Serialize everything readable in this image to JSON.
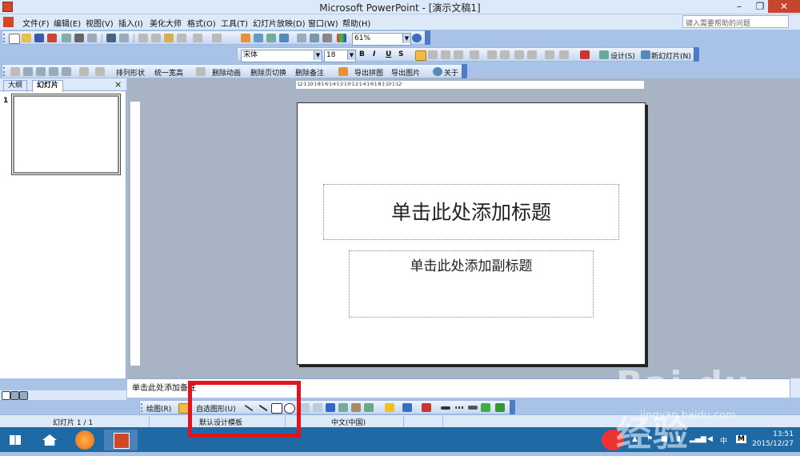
{
  "window": {
    "title": "Microsoft PowerPoint - [演示文稿1]",
    "minimize": "–",
    "restore": "❐",
    "close": "✕"
  },
  "menu": {
    "items": [
      "文件(F)",
      "编辑(E)",
      "视图(V)",
      "插入(I)",
      "美化大师",
      "格式(O)",
      "工具(T)",
      "幻灯片放映(D)",
      "窗口(W)",
      "帮助(H)"
    ],
    "help_placeholder": "键入需要帮助的问题"
  },
  "standard_toolbar": {
    "zoom": "61%"
  },
  "formatting_toolbar": {
    "font": "宋体",
    "size": "18",
    "bold": "B",
    "italic": "I",
    "underline": "U",
    "shadow": "S",
    "design": "设计(S)",
    "new_slide": "新幻灯片(N)"
  },
  "custom_toolbar": {
    "items": [
      "排列形状",
      "统一宽高",
      "删除动画",
      "删除页切换",
      "删除备注",
      "导出拼图",
      "导出图片",
      "关于"
    ]
  },
  "panel": {
    "tab_outline": "大纲",
    "tab_slides": "幻灯片",
    "close": "×",
    "slide_number": "1"
  },
  "ruler": {
    "horizontal": "·12·1·10·1·8·1·6·1·4·1·2·1·0·1·2·1·4·1·6·1·8·1·10·1·12·"
  },
  "slide": {
    "title_placeholder": "单击此处添加标题",
    "subtitle_placeholder": "单击此处添加副标题"
  },
  "notes": {
    "placeholder": "单击此处添加备注"
  },
  "drawing_toolbar": {
    "draw": "绘图(R)",
    "autoshapes": "自选图形(U)"
  },
  "status": {
    "slide": "幻灯片 1 / 1",
    "template": "默认设计模板",
    "language": "中文(中国)"
  },
  "taskbar": {
    "time": "13:51",
    "date": "2015/12/27",
    "ime": "中",
    "ime2": "M"
  },
  "watermark": {
    "brand": "Bai du 经验",
    "url": "jingyan.baidu.com"
  }
}
